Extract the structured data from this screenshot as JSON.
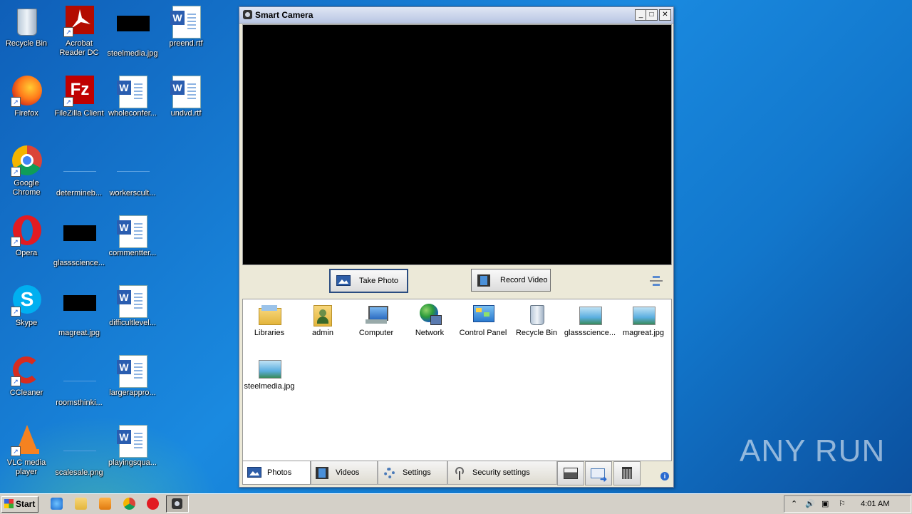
{
  "desktop": {
    "icons": [
      {
        "label": "Recycle Bin",
        "kind": "recycle"
      },
      {
        "label": "Acrobat Reader DC",
        "kind": "acrobat"
      },
      {
        "label": "steelmedia.jpg",
        "kind": "black"
      },
      {
        "label": "preend.rtf",
        "kind": "word"
      },
      {
        "label": "Firefox",
        "kind": "firefox"
      },
      {
        "label": "FileZilla Client",
        "kind": "filezilla"
      },
      {
        "label": "wholeconfer...",
        "kind": "word"
      },
      {
        "label": "undvd.rtf",
        "kind": "word"
      },
      {
        "label": "Google Chrome",
        "kind": "chrome"
      },
      {
        "label": "determineb...",
        "kind": "blank"
      },
      {
        "label": "workerscult...",
        "kind": "blank"
      },
      {
        "label": "Opera",
        "kind": "opera"
      },
      {
        "label": "glassscience...",
        "kind": "black"
      },
      {
        "label": "commentter...",
        "kind": "word"
      },
      {
        "label": "Skype",
        "kind": "skype"
      },
      {
        "label": "magreat.jpg",
        "kind": "black"
      },
      {
        "label": "difficultlevel...",
        "kind": "word"
      },
      {
        "label": "CCleaner",
        "kind": "ccleaner"
      },
      {
        "label": "roomsthinki...",
        "kind": "blank"
      },
      {
        "label": "largerappro...",
        "kind": "word"
      },
      {
        "label": "VLC media player",
        "kind": "vlc"
      },
      {
        "label": "scalesale.png",
        "kind": "blank"
      },
      {
        "label": "playingsqua...",
        "kind": "word"
      }
    ],
    "watermark": "ANY RUN"
  },
  "window": {
    "title": "Smart Camera",
    "take_photo_label": "Take Photo",
    "record_video_label": "Record Video",
    "files": [
      {
        "label": "Libraries",
        "kind": "libraries"
      },
      {
        "label": "admin",
        "kind": "user"
      },
      {
        "label": "Computer",
        "kind": "computer"
      },
      {
        "label": "Network",
        "kind": "network"
      },
      {
        "label": "Control Panel",
        "kind": "controlpanel"
      },
      {
        "label": "Recycle Bin",
        "kind": "recycle"
      },
      {
        "label": "glassscience...",
        "kind": "image"
      },
      {
        "label": "magreat.jpg",
        "kind": "image"
      },
      {
        "label": "steelmedia.jpg",
        "kind": "image"
      }
    ],
    "tabs": [
      {
        "label": "Photos",
        "active": true
      },
      {
        "label": "Videos",
        "active": false
      },
      {
        "label": "Settings",
        "active": false
      },
      {
        "label": "Security settings",
        "active": false
      }
    ]
  },
  "taskbar": {
    "start_label": "Start",
    "clock": "4:01 AM"
  }
}
